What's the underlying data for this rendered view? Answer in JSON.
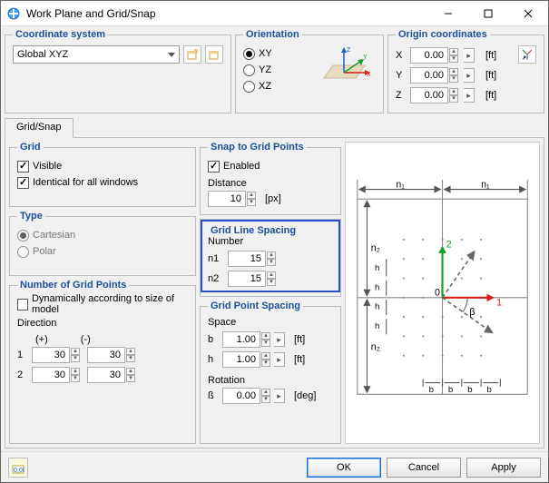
{
  "window": {
    "title": "Work Plane and Grid/Snap"
  },
  "coord": {
    "legend": "Coordinate system",
    "value": "Global XYZ"
  },
  "orientation": {
    "legend": "Orientation",
    "options": [
      "XY",
      "YZ",
      "XZ"
    ],
    "selected": "XY"
  },
  "origin": {
    "legend": "Origin coordinates",
    "rows": [
      {
        "axis": "X",
        "value": "0.00",
        "unit": "[ft]"
      },
      {
        "axis": "Y",
        "value": "0.00",
        "unit": "[ft]"
      },
      {
        "axis": "Z",
        "value": "0.00",
        "unit": "[ft]"
      }
    ]
  },
  "tab": {
    "gridsnap": "Grid/Snap"
  },
  "grid": {
    "legend": "Grid",
    "visible": "Visible",
    "identical": "Identical for all windows"
  },
  "type": {
    "legend": "Type",
    "cartesian": "Cartesian",
    "polar": "Polar"
  },
  "numpoints": {
    "legend": "Number of Grid Points",
    "dyn": "Dynamically according to size of model",
    "direction": "Direction",
    "posHdr": "(+)",
    "negHdr": "(-)",
    "rows": [
      {
        "label": "1",
        "pos": "30",
        "neg": "30"
      },
      {
        "label": "2",
        "pos": "30",
        "neg": "30"
      }
    ]
  },
  "snap": {
    "legend": "Snap to Grid Points",
    "enabled": "Enabled",
    "distanceLbl": "Distance",
    "distance": "10",
    "distUnit": "[px]"
  },
  "linespacing": {
    "legend": "Grid Line Spacing",
    "numberLbl": "Number",
    "rows": [
      {
        "label": "n1",
        "value": "15"
      },
      {
        "label": "n2",
        "value": "15"
      }
    ]
  },
  "pointspacing": {
    "legend": "Grid Point Spacing",
    "spaceLbl": "Space",
    "rows": [
      {
        "label": "b",
        "value": "1.00",
        "unit": "[ft]"
      },
      {
        "label": "h",
        "value": "1.00",
        "unit": "[ft]"
      }
    ],
    "rotationLbl": "Rotation",
    "rotRow": {
      "label": "ß",
      "value": "0.00",
      "unit": "[deg]"
    }
  },
  "buttons": {
    "ok": "OK",
    "cancel": "Cancel",
    "apply": "Apply"
  }
}
